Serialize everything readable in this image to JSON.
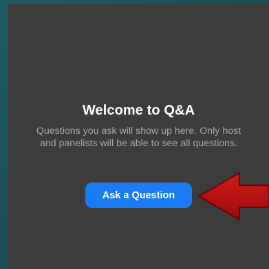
{
  "qa_panel": {
    "title": "Welcome to Q&A",
    "description": "Questions you ask will show up here. Only host\nand panelists will be able to see all questions.",
    "ask_button_label": "Ask a Question"
  },
  "annotation": {
    "arrow_icon": "left-arrow-icon",
    "arrow_color": "#b01010"
  },
  "colors": {
    "panel_bg": "#3c3c3c",
    "button_bg": "#1a7cf4"
  }
}
